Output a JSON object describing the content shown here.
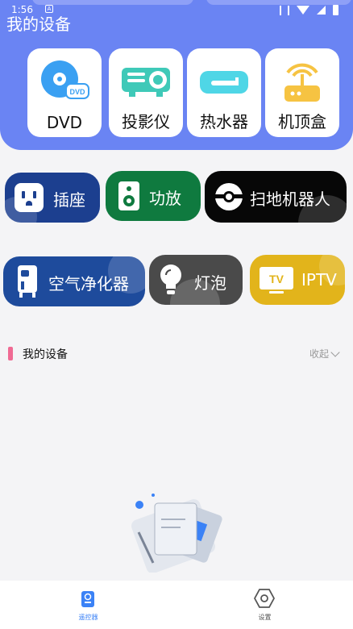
{
  "status_bar": {
    "time": "1:56",
    "notification_icon": "A"
  },
  "header": {
    "title": "我的设备"
  },
  "featured_devices": [
    {
      "label": "DVD",
      "icon": "dvd-icon"
    },
    {
      "label": "投影仪",
      "icon": "projector-icon"
    },
    {
      "label": "热水器",
      "icon": "water-heater-icon"
    },
    {
      "label": "机顶盒",
      "icon": "set-top-box-icon"
    }
  ],
  "device_types_row1": [
    {
      "label": "插座",
      "icon": "socket-icon",
      "color": "#1c3f8f"
    },
    {
      "label": "功放",
      "icon": "speaker-icon",
      "color": "#0f7a3f"
    },
    {
      "label": "扫地机器人",
      "icon": "robot-vacuum-icon",
      "color": "#070707"
    }
  ],
  "device_types_row2": [
    {
      "label": "空气净化器",
      "icon": "air-purifier-icon",
      "color": "#1e4b9c"
    },
    {
      "label": "灯泡",
      "icon": "light-bulb-icon",
      "color": "#4a4a4a"
    },
    {
      "label": "IPTV",
      "icon": "tv-icon",
      "color": "#e2b41b"
    }
  ],
  "my_devices_section": {
    "title": "我的设备",
    "collapse_label": "收起"
  },
  "empty_state": {
    "icon": "empty-document-icon"
  },
  "tab_bar": [
    {
      "label": "遥控器",
      "icon": "remote-icon",
      "active": true
    },
    {
      "label": "设置",
      "icon": "settings-hexagon-icon",
      "active": false
    }
  ],
  "colors": {
    "primary": "#6a84f3",
    "accent_pink": "#f06a93",
    "active_tab": "#3b82f6"
  }
}
